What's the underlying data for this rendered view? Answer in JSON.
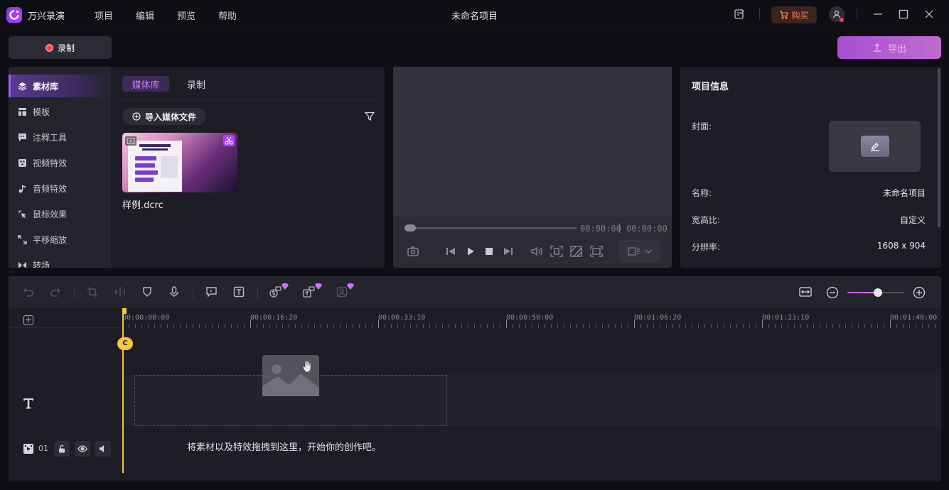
{
  "app": {
    "name": "万兴录演",
    "document_title": "未命名项目"
  },
  "menu": [
    "项目",
    "编辑",
    "预览",
    "帮助"
  ],
  "titlebar": {
    "buy_label": "购买"
  },
  "toolbar": {
    "record_label": "录制",
    "export_label": "导出"
  },
  "sidebar": {
    "items": [
      {
        "label": "素材库",
        "icon": "layers-icon",
        "active": true
      },
      {
        "label": "模板",
        "icon": "template-icon"
      },
      {
        "label": "注释工具",
        "icon": "annotation-icon"
      },
      {
        "label": "视频特效",
        "icon": "video-effects-icon"
      },
      {
        "label": "音频特效",
        "icon": "music-note-icon"
      },
      {
        "label": "鼠标效果",
        "icon": "cursor-click-icon"
      },
      {
        "label": "平移缩放",
        "icon": "pan-zoom-icon"
      },
      {
        "label": "转场",
        "icon": "transition-icon"
      }
    ]
  },
  "media": {
    "tabs": [
      {
        "label": "媒体库",
        "active": true
      },
      {
        "label": "录制"
      }
    ],
    "import_label": "导入媒体文件",
    "items": [
      {
        "name": "样例.dcrc"
      }
    ]
  },
  "preview": {
    "current_time": "00:00:00",
    "total_time": "00:00:00",
    "progress": 0
  },
  "project_info": {
    "title": "项目信息",
    "cover_label": "封面:",
    "fields": [
      {
        "label": "名称:",
        "value": "未命名项目"
      },
      {
        "label": "宽高比:",
        "value": "自定义"
      },
      {
        "label": "分辨率:",
        "value": "1608 x 904"
      }
    ]
  },
  "timeline": {
    "ruler_labels": [
      "00:00:00:00",
      "00:00:16:20",
      "00:00:33:10",
      "00:00:50:00",
      "00:01:06:20",
      "00:01:23:10",
      "00:01:40:00"
    ],
    "zoom_level": 0.55,
    "track_number": "01",
    "drop_hint": "将素材以及特效拖拽到这里，开始你的创作吧。",
    "accent_color": "#f6c544"
  },
  "colors": {
    "accent_purple": "#c45bf2",
    "record_red": "#ff3b3b",
    "buy_orange": "#ff7a45",
    "playhead_yellow": "#f6c544"
  }
}
